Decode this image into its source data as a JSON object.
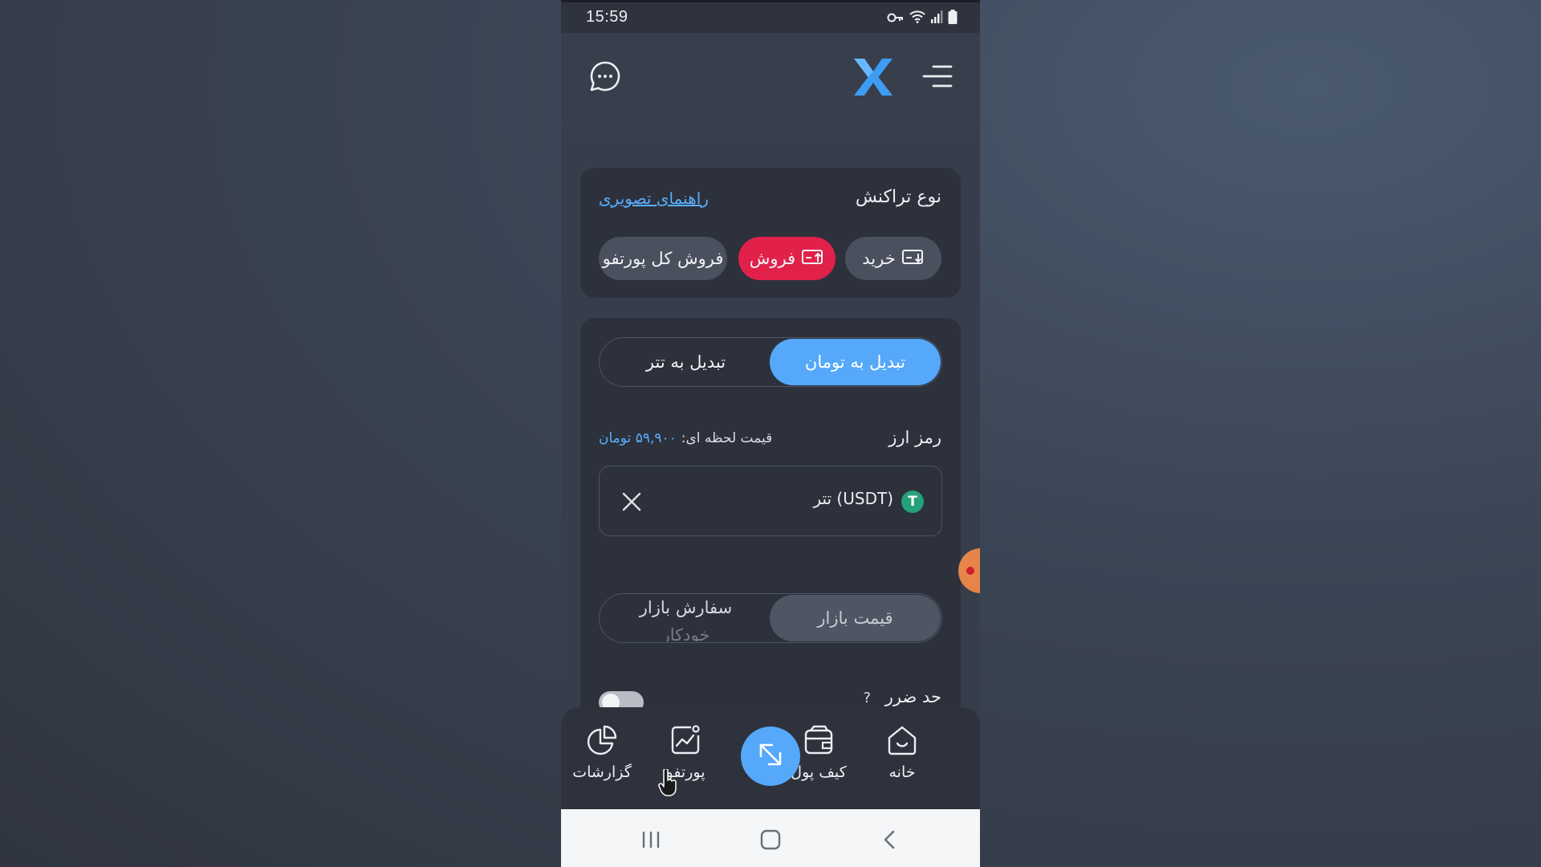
{
  "status_bar": {
    "time": "15:59"
  },
  "header": {
    "logo_text": "X"
  },
  "transaction": {
    "type_label": "نوع تراکنش",
    "guide_link": "راهنمای تصویری",
    "buy_label": "خرید",
    "sell_label": "فروش",
    "sell_all_label": "فروش کل پورتفو"
  },
  "convert": {
    "to_toman": "تبدیل به تومان",
    "to_tether": "تبدیل به تتر"
  },
  "coin": {
    "label": "رمز ارز",
    "price_prefix": "قیمت لحظه ای:",
    "price_value": "۵۹,۹۰۰ تومان",
    "selected": "تتر (USDT)",
    "icon_glyph": "T"
  },
  "order_type": {
    "market_price": "قیمت بازار",
    "market_order_line1": "سفارش بازار",
    "market_order_line2": "خودکار"
  },
  "stop_loss": {
    "label": "حد ضرر",
    "help": "?"
  },
  "bottom_nav": {
    "home": "خانه",
    "wallet": "کیف پول",
    "portfolio": "پورتفو",
    "reports": "گزارشات"
  },
  "colors": {
    "accent_blue": "#55a8fa",
    "sell_red": "#e1214a",
    "tether_green": "#26a17b",
    "card_bg": "#2c313c"
  }
}
